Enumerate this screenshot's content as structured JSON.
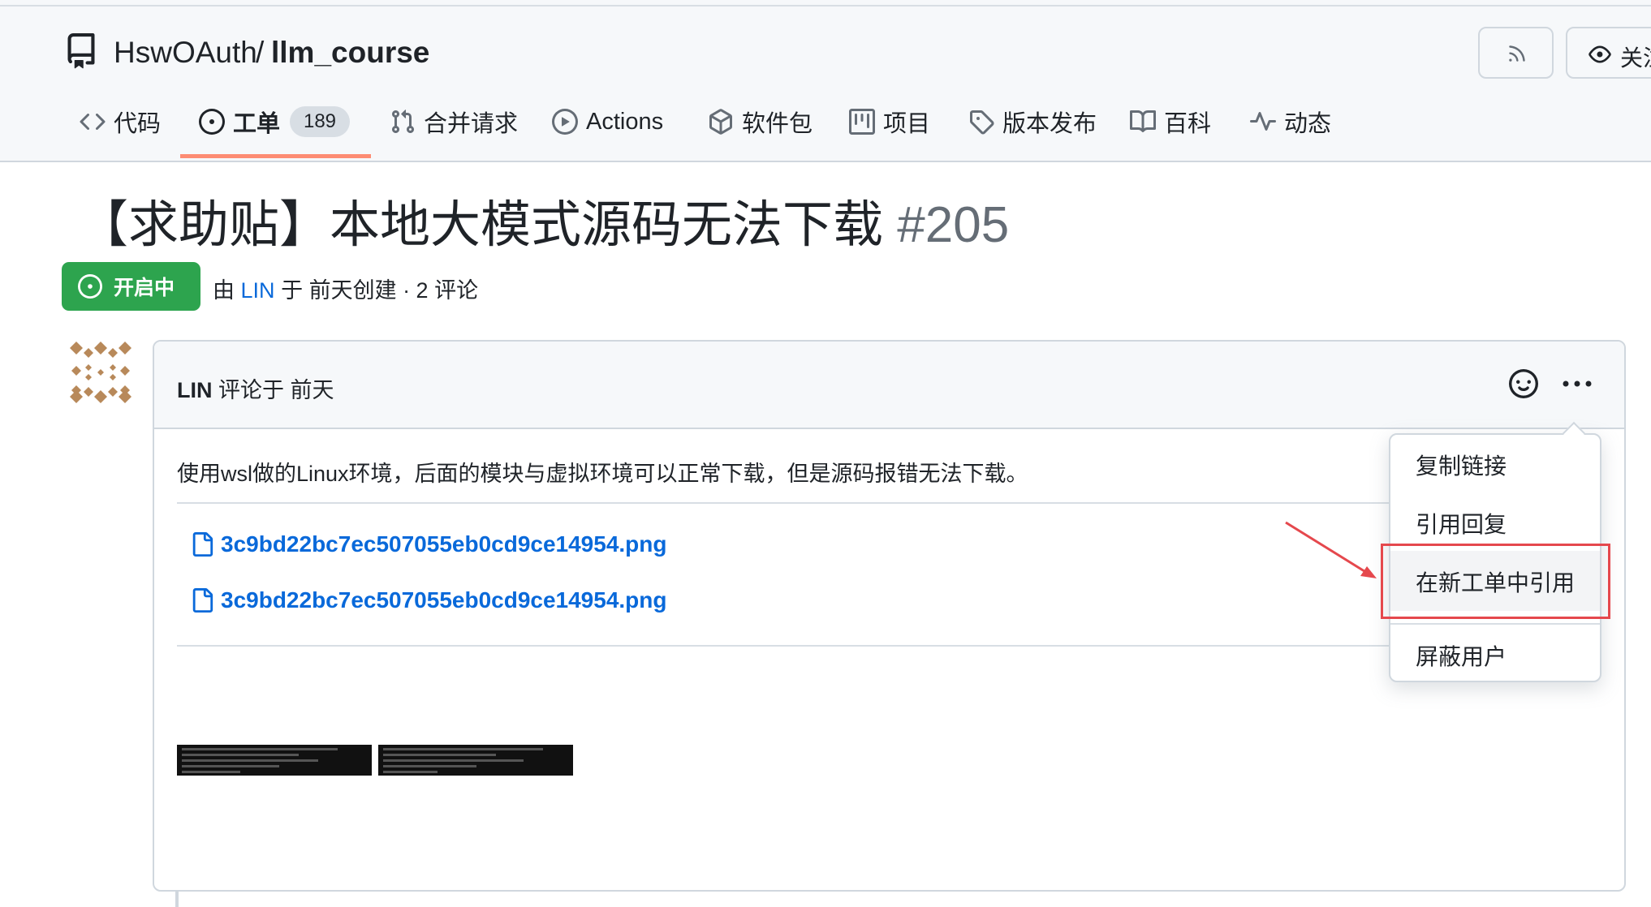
{
  "repo": {
    "owner": "HswOAuth",
    "separator": "/",
    "name": "llm_course",
    "watch_label": "关注"
  },
  "tabs": [
    {
      "label": "代码",
      "icon": "code-icon"
    },
    {
      "label": "工单",
      "icon": "issue-opened-icon",
      "count": "189",
      "selected": true
    },
    {
      "label": "合并请求",
      "icon": "git-pull-request-icon"
    },
    {
      "label": "Actions",
      "icon": "play-icon"
    },
    {
      "label": "软件包",
      "icon": "package-icon"
    },
    {
      "label": "项目",
      "icon": "project-icon"
    },
    {
      "label": "版本发布",
      "icon": "tag-icon"
    },
    {
      "label": "百科",
      "icon": "book-icon"
    },
    {
      "label": "动态",
      "icon": "pulse-icon"
    }
  ],
  "issue": {
    "title": "【求助贴】本地大模式源码无法下载",
    "number": "#205",
    "state": "开启中",
    "meta_by": "由",
    "author": "LIN",
    "meta_rest": "于 前天创建 · 2 评论"
  },
  "comment": {
    "author": "LIN",
    "action": "评论于 前天",
    "body": "使用wsl做的Linux环境，后面的模块与虚拟环境可以正常下载，但是源码报错无法下载。",
    "attachments": [
      "3c9bd22bc7ec507055eb0cd9ce14954.png",
      "3c9bd22bc7ec507055eb0cd9ce14954.png"
    ]
  },
  "menu": {
    "items": [
      "复制链接",
      "引用回复",
      "在新工单中引用",
      "屏蔽用户"
    ],
    "highlighted": "在新工单中引用"
  },
  "colors": {
    "accent": "#0969da",
    "open_state": "#2da44e",
    "annotation": "#e5484d",
    "tab_underline": "#fd8c73"
  }
}
